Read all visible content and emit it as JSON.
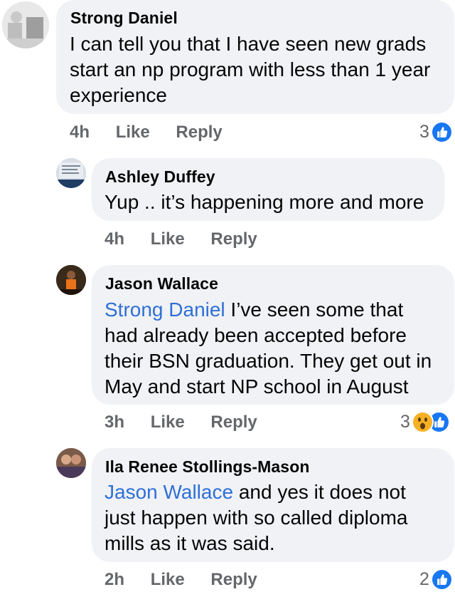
{
  "comments": [
    {
      "author": "Strong Daniel",
      "mention": "",
      "lines": [
        "I can tell you that I have seen new grads",
        "start an np program with less than 1 year",
        "experience"
      ],
      "time": "4h",
      "like_label": "Like",
      "reply_label": "Reply",
      "reaction_count": "3",
      "reactions": [
        "like-icon"
      ]
    },
    {
      "author": "Ashley Duffey",
      "mention": "",
      "lines": [
        "Yup .. it’s happening more and more"
      ],
      "time": "4h",
      "like_label": "Like",
      "reply_label": "Reply",
      "reaction_count": "",
      "reactions": []
    },
    {
      "author": "Jason Wallace",
      "mention": "Strong Daniel",
      "lines": [
        " I’ve seen some that",
        "had already been accepted before",
        "their BSN graduation. They get out in",
        "May and start NP school in August"
      ],
      "time": "3h",
      "like_label": "Like",
      "reply_label": "Reply",
      "reaction_count": "3",
      "reactions": [
        "wow-icon",
        "like-icon"
      ]
    },
    {
      "author": "Ila Renee Stollings-Mason",
      "mention": "Jason Wallace",
      "lines": [
        " and yes it does not",
        "just happen with so called diploma",
        "mills as it was said."
      ],
      "time": "2h",
      "like_label": "Like",
      "reply_label": "Reply",
      "reaction_count": "2",
      "reactions": [
        "like-icon"
      ]
    }
  ],
  "colors": {
    "bubble": "#f0f2f5",
    "mention": "#2f6fd6",
    "meta": "#65676b",
    "like": "#1877f2",
    "wow": "#f7b125"
  }
}
